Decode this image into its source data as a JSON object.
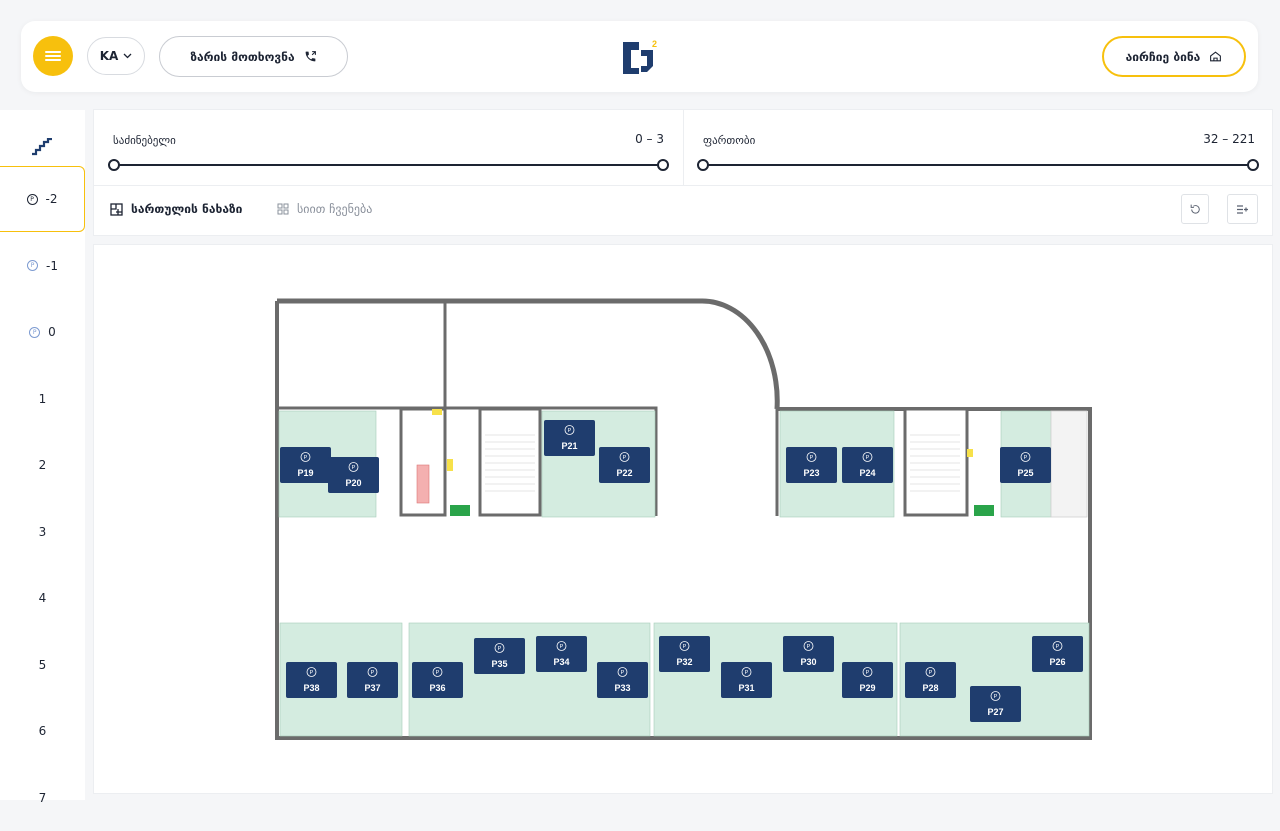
{
  "header": {
    "lang": "KA",
    "call_label": "ზარის მოთხოვნა",
    "choose_label": "აირჩიე ბინა"
  },
  "floors": [
    {
      "label": "-2",
      "parking": true,
      "active": true
    },
    {
      "label": "-1",
      "parking": true,
      "active": false
    },
    {
      "label": "0",
      "parking": true,
      "active": false
    },
    {
      "label": "1",
      "parking": false,
      "active": false
    },
    {
      "label": "2",
      "parking": false,
      "active": false
    },
    {
      "label": "3",
      "parking": false,
      "active": false
    },
    {
      "label": "4",
      "parking": false,
      "active": false
    },
    {
      "label": "5",
      "parking": false,
      "active": false
    },
    {
      "label": "6",
      "parking": false,
      "active": false
    },
    {
      "label": "7",
      "parking": false,
      "active": false
    }
  ],
  "filters": {
    "bedrooms": {
      "label": "საძინებელი",
      "value": "0 – 3"
    },
    "area": {
      "label": "ფართობი",
      "value": "32 – 221"
    }
  },
  "views": {
    "floor_plan": "სართულის ნახაზი",
    "list_view": "სიით ჩვენება"
  },
  "parking_spots": [
    "P19",
    "P20",
    "P21",
    "P22",
    "P23",
    "P24",
    "P25",
    "P26",
    "P27",
    "P28",
    "P29",
    "P30",
    "P31",
    "P32",
    "P33",
    "P34",
    "P35",
    "P36",
    "P37",
    "P38"
  ],
  "colors": {
    "accent": "#f7c00d",
    "navy": "#1f3d6e",
    "spot_fill": "#d4ece0",
    "wall": "#6b6b6b"
  }
}
